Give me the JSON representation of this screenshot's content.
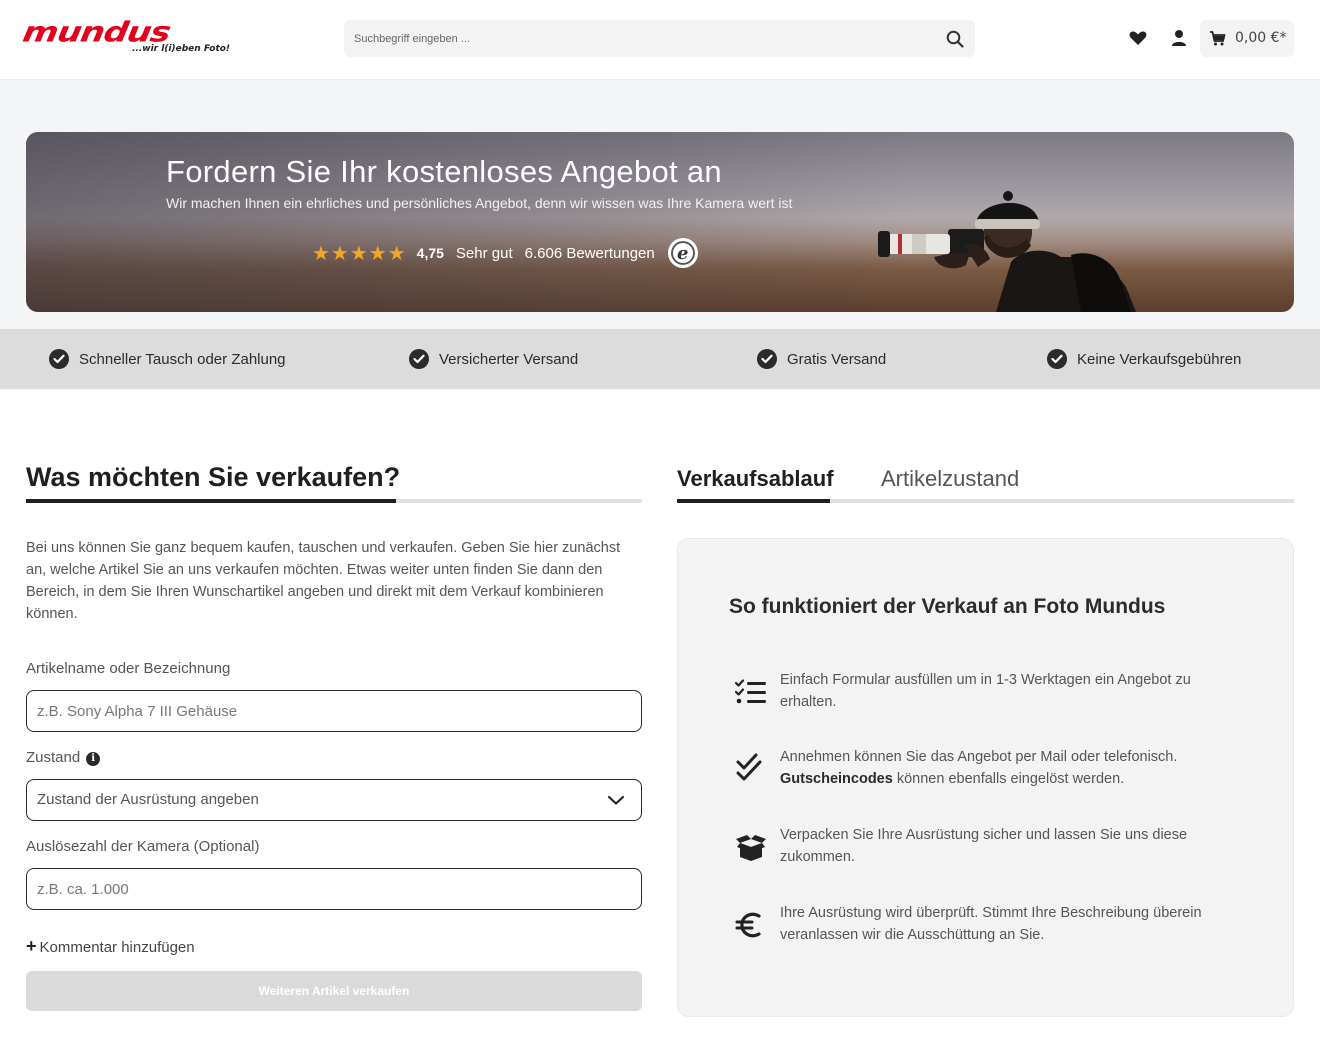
{
  "header": {
    "logo_text": "mundus",
    "logo_tagline": "...wir l(i)eben Foto!",
    "search_placeholder": "Suchbegriff eingeben ...",
    "icons": [
      "search-icon",
      "heart-icon",
      "user-icon",
      "cart-icon"
    ],
    "cart_total": "0,00 €*"
  },
  "banner": {
    "title": "Fordern Sie Ihr kostenloses Angebot an",
    "subtitle": "Wir machen Ihnen ein ehrliches und persönliches Angebot, denn wir wissen was Ihre Kamera wert ist",
    "stars": "★★★★★",
    "rating_value": 4.75,
    "score": "4,75",
    "score_label": "Sehr gut",
    "reviews": "6.606 Bewertungen",
    "badge_letter": "e"
  },
  "usp": [
    {
      "label": "Schneller Tausch oder Zahlung"
    },
    {
      "label": "Versicherter Versand"
    },
    {
      "label": "Gratis Versand"
    },
    {
      "label": "Keine Verkaufsgebühren"
    }
  ],
  "form": {
    "heading": "Was möchten Sie verkaufen?",
    "intro": "Bei uns können Sie ganz bequem kaufen, tauschen und verkaufen. Geben Sie hier zunächst an, welche Artikel Sie an uns verkaufen möchten. Etwas weiter unten finden Sie dann den Bereich, in dem Sie Ihren Wunschartikel angeben und direkt mit dem Verkauf kombinieren können.",
    "article_label": "Artikelname oder Bezeichnung",
    "article_placeholder": "z.B. Sony Alpha 7 III Gehäuse",
    "condition_label": "Zustand",
    "condition_info": "i",
    "condition_value": "Zustand der Ausrüstung angeben",
    "shutter_label": "Auslösezahl der Kamera (Optional)",
    "shutter_placeholder": "z.B. ca. 1.000",
    "add_comment": "Kommentar hinzufügen",
    "add_comment_plus": "+",
    "submit_label": "Weiteren Artikel verkaufen"
  },
  "tabs": [
    {
      "label": "Verkaufsablauf",
      "active": true
    },
    {
      "label": "Artikelzustand",
      "active": false
    }
  ],
  "panel": {
    "title": "So funktioniert der Verkauf an Foto Mundus",
    "steps": [
      {
        "icon": "checklist-icon",
        "text": "Einfach Formular ausfüllen um in 1-3 Werktagen ein Angebot zu erhalten."
      },
      {
        "icon": "double-check-icon",
        "text_bold": "Annehmen können Sie das Angebot per Mail oder telefonisch.",
        "text_strong": "Gutscheincodes",
        "text_after": " können ebenfalls eingelöst werden."
      },
      {
        "icon": "box-icon",
        "text": "Verpacken Sie Ihre Ausrüstung sicher und lassen Sie uns diese zukommen."
      },
      {
        "icon": "euro-icon",
        "text": "Ihre Ausrüstung wird überprüft. Stimmt Ihre Beschreibung überein veranlassen wir die Ausschüttung an Sie."
      }
    ]
  },
  "colors": {
    "brand": "#e3001b",
    "star": "#f5a623",
    "text_dark": "#1f1f1f",
    "usp_bg": "#dcdcdc",
    "panel_bg": "#f3f3f3"
  }
}
